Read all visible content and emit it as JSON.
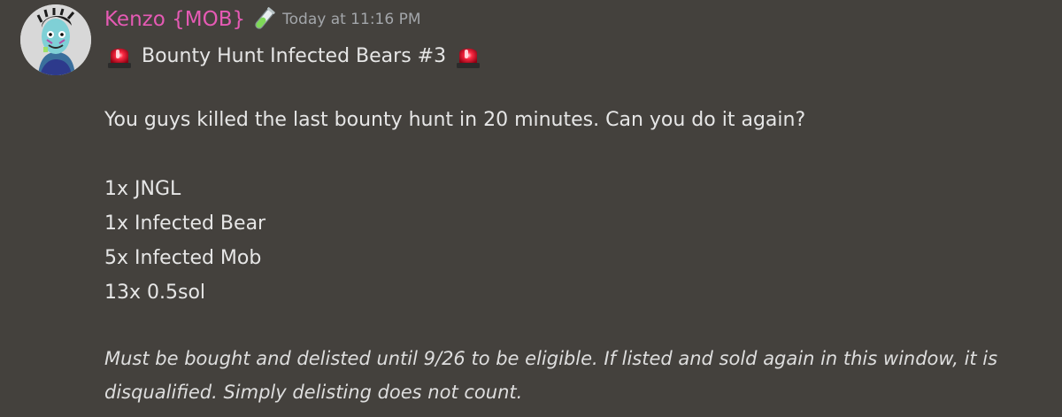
{
  "message": {
    "author": "Kenzo {MOB}",
    "author_color": "#e55ab4",
    "role_icon": "test-tube-icon",
    "timestamp": "Today at 11:16 PM",
    "title_icon": "police-siren-icon",
    "title": "Bounty Hunt Infected Bears #3",
    "intro": "You guys killed the last bounty hunt in 20 minutes. Can you do it again?",
    "items": [
      "1x JNGL",
      "1x Infected Bear",
      "5x Infected Mob",
      "13x 0.5sol"
    ],
    "note": "Must be bought and delisted until 9/26 to be eligible. If listed and sold again in this window, it is disqualified. Simply delisting does not count."
  },
  "colors": {
    "background": "#44413d",
    "text": "#e6e6e6",
    "timestamp": "#a3a6aa"
  }
}
